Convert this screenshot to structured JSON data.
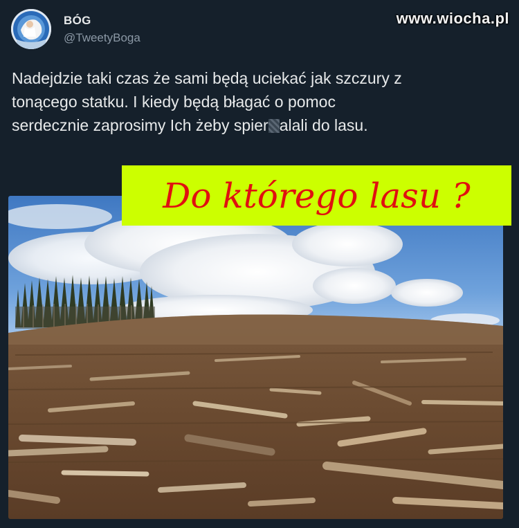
{
  "tweet": {
    "display_name": "BÓG",
    "handle": "@TweetyBoga",
    "line1": "Nadejdzie taki czas że sami będą uciekać jak szczury z",
    "line2": "tonącego statku. I kiedy będą błagać o pomoc",
    "line3_start": "serdecznie zaprosimy Ich żeby spier",
    "line3_end": "alali do lasu."
  },
  "watermark": "www.wiocha.pl",
  "overlay_caption": "Do którego lasu ?",
  "icons": {
    "avatar": "avatar-illustration"
  },
  "colors": {
    "background": "#15202b",
    "text": "#e7e9ea",
    "secondary_text": "#8b98a5",
    "caption_bg": "#ccff00",
    "caption_text": "#e01010"
  }
}
